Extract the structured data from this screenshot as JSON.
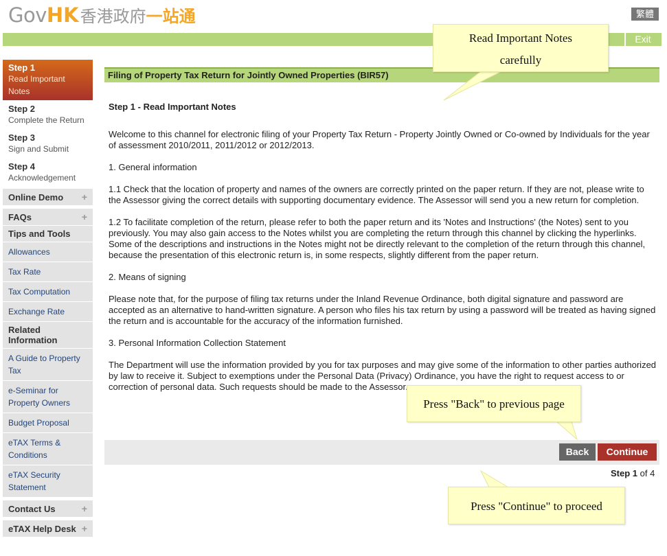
{
  "header": {
    "logo_gov": "Gov",
    "logo_hk": "HK",
    "logo_cn1": "香港政府",
    "logo_cn2": "一站通",
    "lang_label": "繁體",
    "exit_label": "Exit"
  },
  "sidebar": {
    "steps": [
      {
        "title": "Step 1",
        "sub": "Read Important Notes"
      },
      {
        "title": "Step 2",
        "sub": "Complete the Return"
      },
      {
        "title": "Step 3",
        "sub": "Sign and Submit"
      },
      {
        "title": "Step 4",
        "sub": "Acknowledgement"
      }
    ],
    "online_demo": "Online Demo",
    "faqs": "FAQs",
    "tips_tools": "Tips and Tools",
    "tips_links": [
      "Allowances",
      "Tax Rate",
      "Tax Computation",
      "Exchange Rate"
    ],
    "related_info": "Related Information",
    "related_links": [
      "A Guide to Property Tax",
      "e-Seminar for Property Owners",
      "Budget Proposal",
      "eTAX Terms & Conditions",
      "eTAX Security Statement"
    ],
    "contact_us": "Contact Us",
    "help_desk": "eTAX Help Desk"
  },
  "main": {
    "bar_title": "Filing of Property Tax Return for Jointly Owned Properties (BIR57)",
    "heading": "Step 1  -  Read Important Notes",
    "paragraphs": [
      "Welcome to this channel for electronic filing of your Property Tax Return - Property Jointly Owned or Co-owned by Individuals for the year of assessment 2010/2011, 2011/2012 or 2012/2013.",
      "1.  General information",
      "1.1  Check that the location of property and names of the owners are correctly printed on the paper return.  If they are not, please write to the Assessor giving the correct details with supporting documentary evidence.  The Assessor will send you a new return for completion.",
      "1.2  To facilitate completion of the return, please refer to both the paper return and its 'Notes and Instructions' (the Notes) sent to you previously.  You may also gain access to the Notes whilst you are completing the return through this channel by clicking the hyperlinks.  Some of the descriptions and instructions in the Notes might not be directly relevant to the completion of the return through this channel, because the presentation of this electronic return is, in some respects, slightly different from the paper return.",
      "2.  Means of signing",
      "Please note that, for the purpose of filing tax returns under the Inland Revenue Ordinance, both digital signature and password are accepted as an alternative to hand-written signature.  A person who files his tax return by using a password will be treated as having signed the return and is accountable for the accuracy of the information furnished.",
      "3.  Personal Information Collection Statement",
      "The Department will use the information provided by you for tax purposes and may give some of the information to other parties authorized by law to receive it.  Subject to exemptions under the Personal Data (Privacy) Ordinance, you have the right to request access to or correction of personal data.  Such requests should be made to the Assessor."
    ],
    "back_label": "Back",
    "continue_label": "Continue",
    "step_prefix": "Step",
    "step_current": "1",
    "step_of": "of 4"
  },
  "callouts": {
    "notes_line1": "Read Important Notes",
    "notes_line2": "carefully",
    "back": "Press \"Back\" to previous page",
    "continue": "Press \"Continue\" to proceed"
  }
}
